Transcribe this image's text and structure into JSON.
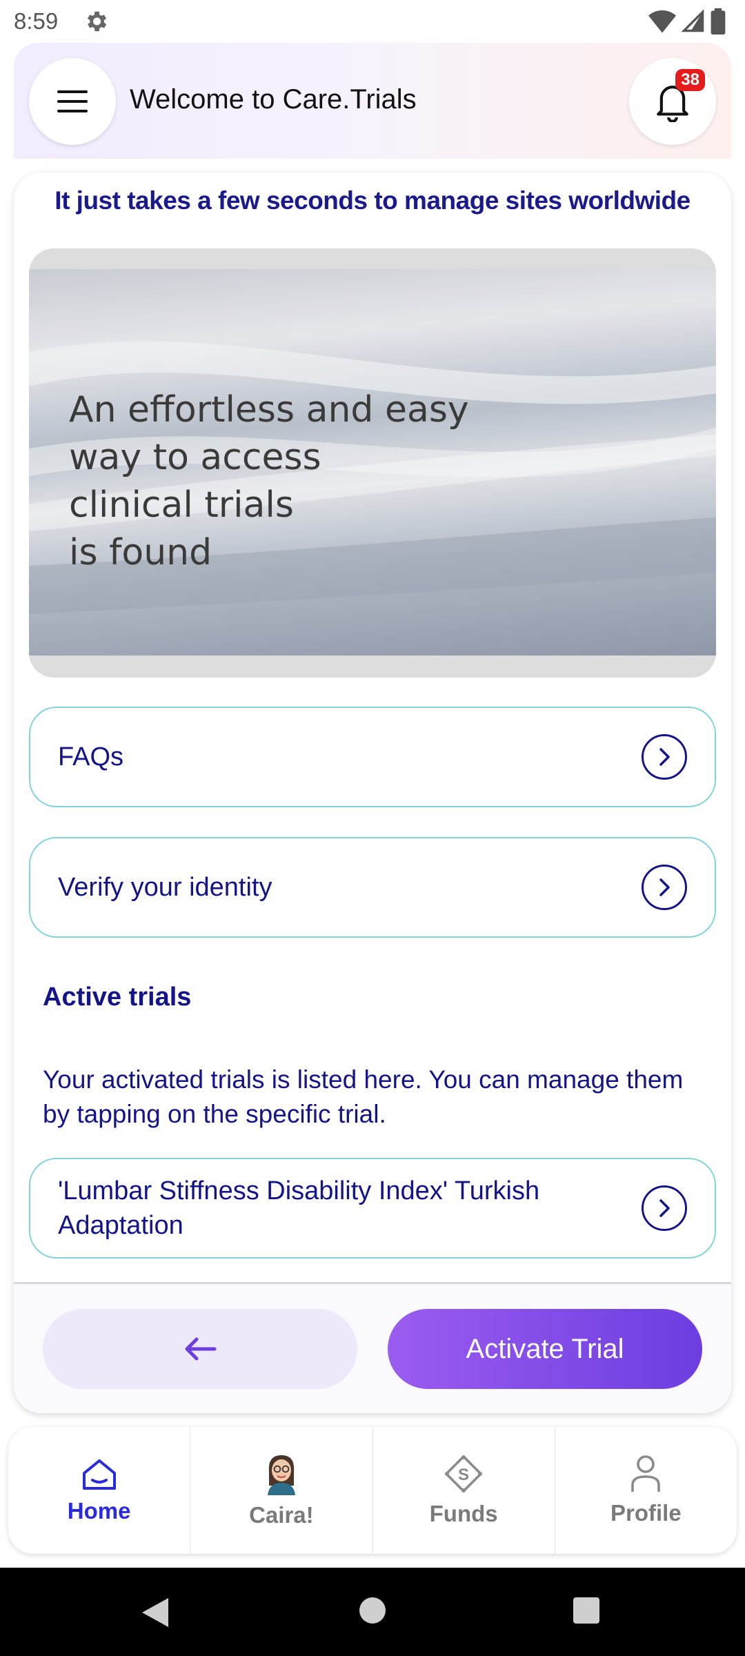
{
  "status_bar": {
    "time": "8:59"
  },
  "header": {
    "title": "Welcome to Care.Trials",
    "notification_count": "38"
  },
  "main": {
    "tagline": "It just takes a few seconds to manage sites worldwide",
    "banner": {
      "line1": "An effortless and easy",
      "line2": "way to access",
      "line3": "clinical trials",
      "line4": "is found"
    },
    "links": [
      {
        "label": "FAQs"
      },
      {
        "label": "Verify your identity"
      }
    ],
    "active_trials": {
      "title": "Active trials",
      "description": "Your activated trials is listed here. You can manage them by tapping on the specific trial.",
      "items": [
        {
          "label": "'Lumbar Stiffness Disability Index' Turkish Adaptation"
        }
      ]
    },
    "actions": {
      "activate_label": "Activate Trial"
    }
  },
  "bottom_nav": {
    "items": [
      {
        "label": "Home",
        "icon": "home-icon",
        "active": true
      },
      {
        "label": "Caira!",
        "icon": "avatar",
        "active": false
      },
      {
        "label": "Funds",
        "icon": "funds-icon",
        "active": false
      },
      {
        "label": "Profile",
        "icon": "profile-icon",
        "active": false
      }
    ]
  },
  "colors": {
    "accent": "#6c3ee0",
    "text_primary": "#14148a",
    "badge": "#e61b1b",
    "border": "#7fd4dc"
  }
}
